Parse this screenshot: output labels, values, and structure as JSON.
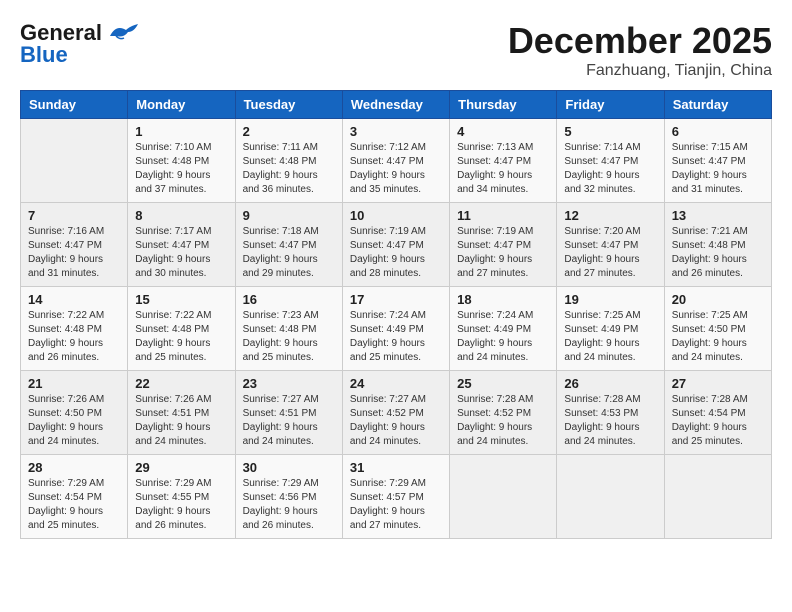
{
  "header": {
    "logo_line1": "General",
    "logo_line2": "Blue",
    "month_title": "December 2025",
    "subtitle": "Fanzhuang, Tianjin, China"
  },
  "days_of_week": [
    "Sunday",
    "Monday",
    "Tuesday",
    "Wednesday",
    "Thursday",
    "Friday",
    "Saturday"
  ],
  "weeks": [
    [
      {
        "day": "",
        "info": ""
      },
      {
        "day": "1",
        "info": "Sunrise: 7:10 AM\nSunset: 4:48 PM\nDaylight: 9 hours\nand 37 minutes."
      },
      {
        "day": "2",
        "info": "Sunrise: 7:11 AM\nSunset: 4:48 PM\nDaylight: 9 hours\nand 36 minutes."
      },
      {
        "day": "3",
        "info": "Sunrise: 7:12 AM\nSunset: 4:47 PM\nDaylight: 9 hours\nand 35 minutes."
      },
      {
        "day": "4",
        "info": "Sunrise: 7:13 AM\nSunset: 4:47 PM\nDaylight: 9 hours\nand 34 minutes."
      },
      {
        "day": "5",
        "info": "Sunrise: 7:14 AM\nSunset: 4:47 PM\nDaylight: 9 hours\nand 32 minutes."
      },
      {
        "day": "6",
        "info": "Sunrise: 7:15 AM\nSunset: 4:47 PM\nDaylight: 9 hours\nand 31 minutes."
      }
    ],
    [
      {
        "day": "7",
        "info": "Sunrise: 7:16 AM\nSunset: 4:47 PM\nDaylight: 9 hours\nand 31 minutes."
      },
      {
        "day": "8",
        "info": "Sunrise: 7:17 AM\nSunset: 4:47 PM\nDaylight: 9 hours\nand 30 minutes."
      },
      {
        "day": "9",
        "info": "Sunrise: 7:18 AM\nSunset: 4:47 PM\nDaylight: 9 hours\nand 29 minutes."
      },
      {
        "day": "10",
        "info": "Sunrise: 7:19 AM\nSunset: 4:47 PM\nDaylight: 9 hours\nand 28 minutes."
      },
      {
        "day": "11",
        "info": "Sunrise: 7:19 AM\nSunset: 4:47 PM\nDaylight: 9 hours\nand 27 minutes."
      },
      {
        "day": "12",
        "info": "Sunrise: 7:20 AM\nSunset: 4:47 PM\nDaylight: 9 hours\nand 27 minutes."
      },
      {
        "day": "13",
        "info": "Sunrise: 7:21 AM\nSunset: 4:48 PM\nDaylight: 9 hours\nand 26 minutes."
      }
    ],
    [
      {
        "day": "14",
        "info": "Sunrise: 7:22 AM\nSunset: 4:48 PM\nDaylight: 9 hours\nand 26 minutes."
      },
      {
        "day": "15",
        "info": "Sunrise: 7:22 AM\nSunset: 4:48 PM\nDaylight: 9 hours\nand 25 minutes."
      },
      {
        "day": "16",
        "info": "Sunrise: 7:23 AM\nSunset: 4:48 PM\nDaylight: 9 hours\nand 25 minutes."
      },
      {
        "day": "17",
        "info": "Sunrise: 7:24 AM\nSunset: 4:49 PM\nDaylight: 9 hours\nand 25 minutes."
      },
      {
        "day": "18",
        "info": "Sunrise: 7:24 AM\nSunset: 4:49 PM\nDaylight: 9 hours\nand 24 minutes."
      },
      {
        "day": "19",
        "info": "Sunrise: 7:25 AM\nSunset: 4:49 PM\nDaylight: 9 hours\nand 24 minutes."
      },
      {
        "day": "20",
        "info": "Sunrise: 7:25 AM\nSunset: 4:50 PM\nDaylight: 9 hours\nand 24 minutes."
      }
    ],
    [
      {
        "day": "21",
        "info": "Sunrise: 7:26 AM\nSunset: 4:50 PM\nDaylight: 9 hours\nand 24 minutes."
      },
      {
        "day": "22",
        "info": "Sunrise: 7:26 AM\nSunset: 4:51 PM\nDaylight: 9 hours\nand 24 minutes."
      },
      {
        "day": "23",
        "info": "Sunrise: 7:27 AM\nSunset: 4:51 PM\nDaylight: 9 hours\nand 24 minutes."
      },
      {
        "day": "24",
        "info": "Sunrise: 7:27 AM\nSunset: 4:52 PM\nDaylight: 9 hours\nand 24 minutes."
      },
      {
        "day": "25",
        "info": "Sunrise: 7:28 AM\nSunset: 4:52 PM\nDaylight: 9 hours\nand 24 minutes."
      },
      {
        "day": "26",
        "info": "Sunrise: 7:28 AM\nSunset: 4:53 PM\nDaylight: 9 hours\nand 24 minutes."
      },
      {
        "day": "27",
        "info": "Sunrise: 7:28 AM\nSunset: 4:54 PM\nDaylight: 9 hours\nand 25 minutes."
      }
    ],
    [
      {
        "day": "28",
        "info": "Sunrise: 7:29 AM\nSunset: 4:54 PM\nDaylight: 9 hours\nand 25 minutes."
      },
      {
        "day": "29",
        "info": "Sunrise: 7:29 AM\nSunset: 4:55 PM\nDaylight: 9 hours\nand 26 minutes."
      },
      {
        "day": "30",
        "info": "Sunrise: 7:29 AM\nSunset: 4:56 PM\nDaylight: 9 hours\nand 26 minutes."
      },
      {
        "day": "31",
        "info": "Sunrise: 7:29 AM\nSunset: 4:57 PM\nDaylight: 9 hours\nand 27 minutes."
      },
      {
        "day": "",
        "info": ""
      },
      {
        "day": "",
        "info": ""
      },
      {
        "day": "",
        "info": ""
      }
    ]
  ]
}
